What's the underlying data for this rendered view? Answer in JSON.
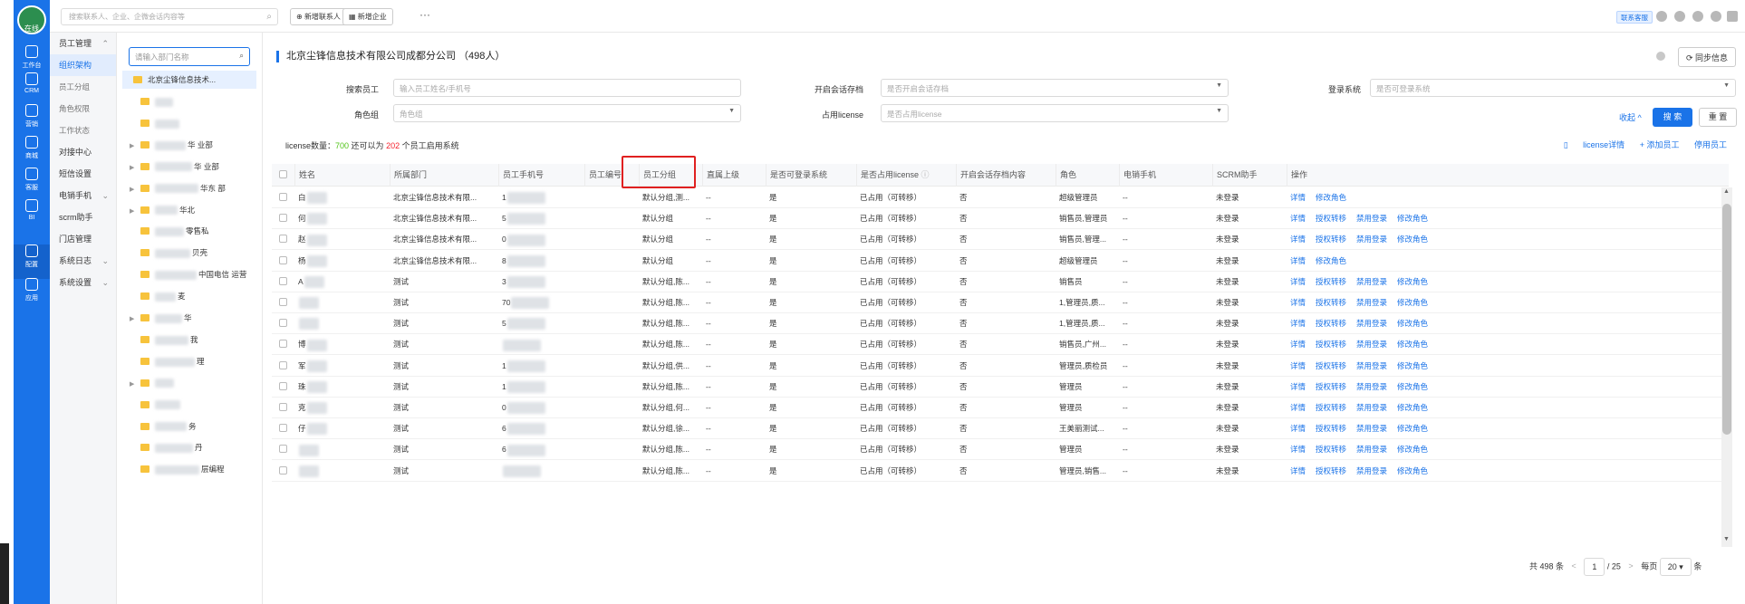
{
  "app": {
    "logo_text": "在线"
  },
  "rail": [
    {
      "label": "工作台",
      "icon": "home-icon"
    },
    {
      "label": "CRM",
      "icon": "user-icon"
    },
    {
      "label": "营销",
      "icon": "chart-icon"
    },
    {
      "label": "商城",
      "icon": "shop-icon"
    },
    {
      "label": "客服",
      "icon": "chat-icon"
    },
    {
      "label": "BI",
      "icon": "pie-icon"
    },
    {
      "label": "配置",
      "icon": "gear-icon"
    },
    {
      "label": "应用",
      "icon": "apps-icon"
    }
  ],
  "topbar": {
    "search_placeholder": "搜索联系人、企业、企微会话内容等",
    "new_contact": "新增联系人",
    "new_company": "新增企业",
    "more": "···",
    "contact_sales": "联系客服"
  },
  "submenu": [
    {
      "label": "员工管理",
      "arrow": "^",
      "type": "group"
    },
    {
      "label": "组织架构",
      "type": "active"
    },
    {
      "label": "员工分组",
      "type": "sub"
    },
    {
      "label": "角色权限",
      "type": "sub"
    },
    {
      "label": "工作状态",
      "type": "sub"
    },
    {
      "label": "对接中心",
      "type": "item"
    },
    {
      "label": "短信设置",
      "type": "item"
    },
    {
      "label": "电销手机",
      "arrow": "v",
      "type": "item"
    },
    {
      "label": "scrm助手",
      "type": "item"
    },
    {
      "label": "门店管理",
      "type": "item"
    },
    {
      "label": "系统日志",
      "arrow": "v",
      "type": "item"
    },
    {
      "label": "系统设置",
      "arrow": "v",
      "type": "item"
    }
  ],
  "dept": {
    "search_placeholder": "请输入部门名称",
    "root": "北京尘锋信息技术...",
    "items": [
      {
        "label": "",
        "caret": false
      },
      {
        "label": "",
        "caret": false
      },
      {
        "label": "华  业部",
        "caret": true
      },
      {
        "label": "华  业部",
        "caret": true
      },
      {
        "label": "华东  部",
        "caret": true
      },
      {
        "label": "华北",
        "caret": true
      },
      {
        "label": "零售私",
        "caret": false
      },
      {
        "label": "贝壳",
        "caret": false
      },
      {
        "label": "中国电信  运营",
        "caret": false
      },
      {
        "label": "麦",
        "caret": false
      },
      {
        "label": "华",
        "caret": true
      },
      {
        "label": "我",
        "caret": false
      },
      {
        "label": "理",
        "caret": false
      },
      {
        "label": "",
        "caret": true
      },
      {
        "label": "",
        "caret": false
      },
      {
        "label": "务",
        "caret": false
      },
      {
        "label": "丹",
        "caret": false
      },
      {
        "label": "层编程",
        "caret": false
      }
    ]
  },
  "main": {
    "title": "北京尘锋信息技术有限公司成都分公司 （498人）",
    "sync": "同步信息",
    "filters": {
      "search_employee_label": "搜索员工",
      "search_employee_placeholder": "输入员工姓名/手机号",
      "archive_label": "开启会话存档",
      "archive_placeholder": "是否开启会话存档",
      "login_label": "登录系统",
      "login_placeholder": "是否可登录系统",
      "role_label": "角色组",
      "role_placeholder": "角色组",
      "license_label": "占用license",
      "license_placeholder": "是否占用license",
      "collapse": "收起 ^",
      "search_btn": "搜 索",
      "reset_btn": "重 置"
    },
    "license": {
      "prefix": "license数量：",
      "count": "700",
      "middle": "  还可以为 ",
      "remain": "202",
      "suffix": " 个员工启用系统"
    },
    "actions": {
      "license_detail": "license详情",
      "add_employee": "+ 添加员工",
      "disable": "停用员工"
    },
    "columns": [
      "姓名",
      "所属部门",
      "员工手机号",
      "员工编号",
      "员工分组",
      "直属上级",
      "是否可登录系统",
      "是否占用license",
      "开启会话存档内容",
      "角色",
      "电销手机",
      "SCRM助手",
      "操作"
    ],
    "rows": [
      {
        "name": "白",
        "dept": "北京尘锋信息技术有限...",
        "phone": "1",
        "group": "默认分组,测...",
        "boss": "--",
        "login": "是",
        "license": "已占用（可转移）",
        "archive": "否",
        "role": "超级管理员",
        "mobile": "--",
        "scrm": "未登录",
        "ops": [
          "详情",
          "修改角色"
        ]
      },
      {
        "name": "何",
        "dept": "北京尘锋信息技术有限...",
        "phone": "5",
        "group": "默认分组",
        "boss": "--",
        "login": "是",
        "license": "已占用（可转移）",
        "archive": "否",
        "role": "销售员,管理员",
        "mobile": "--",
        "scrm": "未登录",
        "ops": [
          "详情",
          "授权转移",
          "禁用登录",
          "修改角色"
        ]
      },
      {
        "name": "赵",
        "dept": "北京尘锋信息技术有限...",
        "phone": "0",
        "group": "默认分组",
        "boss": "--",
        "login": "是",
        "license": "已占用（可转移）",
        "archive": "否",
        "role": "销售员,管理...",
        "mobile": "--",
        "scrm": "未登录",
        "ops": [
          "详情",
          "授权转移",
          "禁用登录",
          "修改角色"
        ]
      },
      {
        "name": "杨",
        "dept": "北京尘锋信息技术有限...",
        "phone": "8",
        "group": "默认分组",
        "boss": "--",
        "login": "是",
        "license": "已占用（可转移）",
        "archive": "否",
        "role": "超级管理员",
        "mobile": "--",
        "scrm": "未登录",
        "ops": [
          "详情",
          "修改角色"
        ]
      },
      {
        "name": "A",
        "dept": "测试",
        "phone": "3",
        "group": "默认分组,陈...",
        "boss": "--",
        "login": "是",
        "license": "已占用（可转移）",
        "archive": "否",
        "role": "销售员",
        "mobile": "--",
        "scrm": "未登录",
        "ops": [
          "详情",
          "授权转移",
          "禁用登录",
          "修改角色"
        ]
      },
      {
        "name": "",
        "dept": "测试",
        "phone": "70",
        "group": "默认分组,陈...",
        "boss": "--",
        "login": "是",
        "license": "已占用（可转移）",
        "archive": "否",
        "role": "1,管理员,质...",
        "mobile": "--",
        "scrm": "未登录",
        "ops": [
          "详情",
          "授权转移",
          "禁用登录",
          "修改角色"
        ]
      },
      {
        "name": "",
        "dept": "测试",
        "phone": "5",
        "group": "默认分组,陈...",
        "boss": "--",
        "login": "是",
        "license": "已占用（可转移）",
        "archive": "否",
        "role": "1,管理员,质...",
        "mobile": "--",
        "scrm": "未登录",
        "ops": [
          "详情",
          "授权转移",
          "禁用登录",
          "修改角色"
        ]
      },
      {
        "name": "博",
        "dept": "测试",
        "phone": "",
        "group": "默认分组,陈...",
        "boss": "--",
        "login": "是",
        "license": "已占用（可转移）",
        "archive": "否",
        "role": "销售员,广州...",
        "mobile": "--",
        "scrm": "未登录",
        "ops": [
          "详情",
          "授权转移",
          "禁用登录",
          "修改角色"
        ]
      },
      {
        "name": "军",
        "dept": "测试",
        "phone": "1",
        "group": "默认分组,供...",
        "boss": "--",
        "login": "是",
        "license": "已占用（可转移）",
        "archive": "否",
        "role": "管理员,质检员",
        "mobile": "--",
        "scrm": "未登录",
        "ops": [
          "详情",
          "授权转移",
          "禁用登录",
          "修改角色"
        ]
      },
      {
        "name": "珠",
        "dept": "测试",
        "phone": "1",
        "group": "默认分组,陈...",
        "boss": "--",
        "login": "是",
        "license": "已占用（可转移）",
        "archive": "否",
        "role": "管理员",
        "mobile": "--",
        "scrm": "未登录",
        "ops": [
          "详情",
          "授权转移",
          "禁用登录",
          "修改角色"
        ]
      },
      {
        "name": "克",
        "dept": "测试",
        "phone": "0",
        "group": "默认分组,何...",
        "boss": "--",
        "login": "是",
        "license": "已占用（可转移）",
        "archive": "否",
        "role": "管理员",
        "mobile": "--",
        "scrm": "未登录",
        "ops": [
          "详情",
          "授权转移",
          "禁用登录",
          "修改角色"
        ]
      },
      {
        "name": "仔",
        "dept": "测试",
        "phone": "6",
        "group": "默认分组,徐...",
        "boss": "--",
        "login": "是",
        "license": "已占用（可转移）",
        "archive": "否",
        "role": "王美丽测试...",
        "mobile": "--",
        "scrm": "未登录",
        "ops": [
          "详情",
          "授权转移",
          "禁用登录",
          "修改角色"
        ]
      },
      {
        "name": "",
        "dept": "测试",
        "phone": "6",
        "group": "默认分组,陈...",
        "boss": "--",
        "login": "是",
        "license": "已占用（可转移）",
        "archive": "否",
        "role": "管理员",
        "mobile": "--",
        "scrm": "未登录",
        "ops": [
          "详情",
          "授权转移",
          "禁用登录",
          "修改角色"
        ]
      },
      {
        "name": "",
        "dept": "测试",
        "phone": "",
        "group": "默认分组,陈...",
        "boss": "--",
        "login": "是",
        "license": "已占用（可转移）",
        "archive": "否",
        "role": "管理员,销售...",
        "mobile": "--",
        "scrm": "未登录",
        "ops": [
          "详情",
          "授权转移",
          "禁用登录",
          "修改角色"
        ]
      }
    ],
    "pager": {
      "total": "共 498 条",
      "prev": "<",
      "page": "1",
      "sep": "/",
      "pages": "25",
      "next": ">",
      "per_label": "每页",
      "per_value": "20",
      "unit": "条"
    }
  }
}
